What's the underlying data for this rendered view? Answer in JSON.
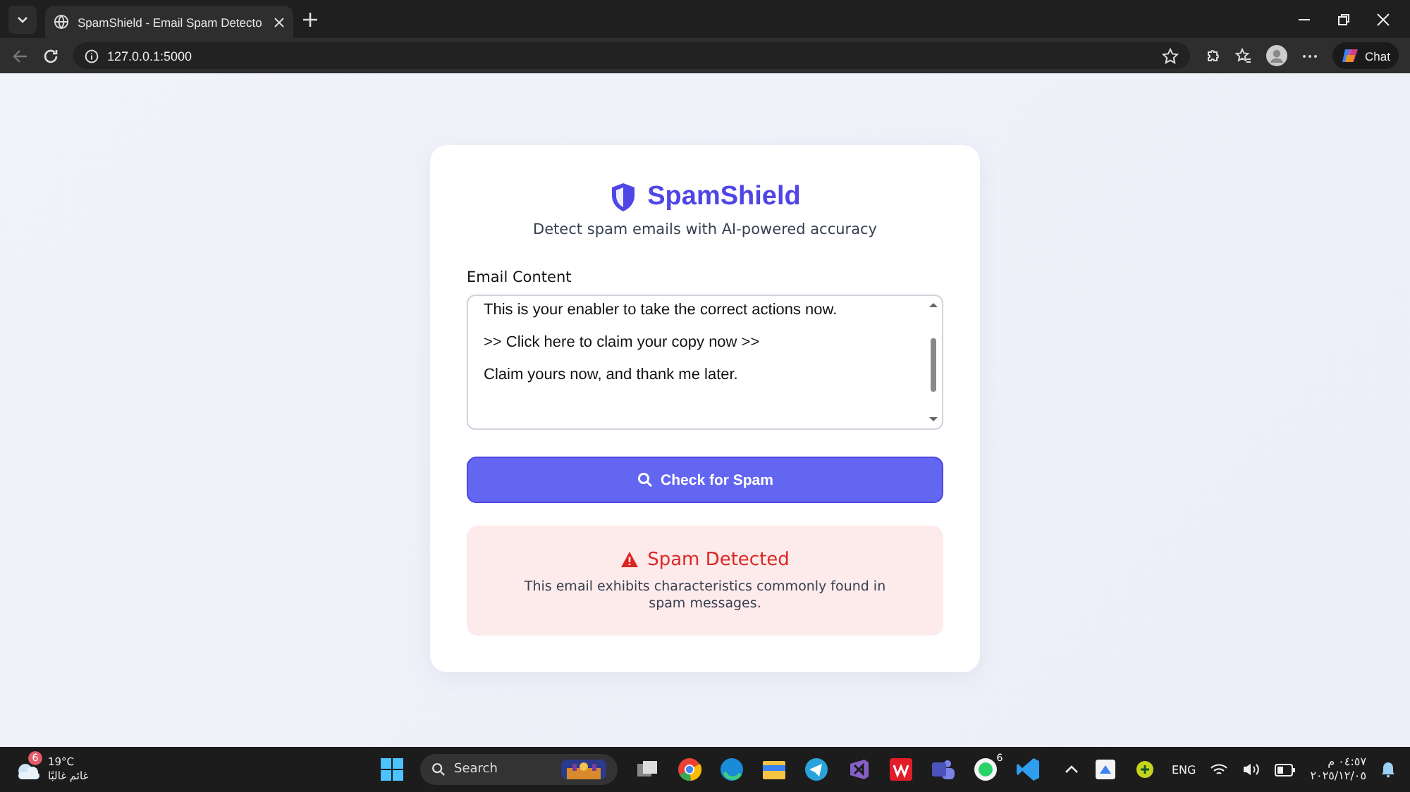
{
  "browser": {
    "tab_title": "SpamShield - Email Spam Detecto",
    "url": "127.0.0.1:5000",
    "chat_label": "Chat"
  },
  "app": {
    "brand": "SpamShield",
    "tagline": "Detect spam emails with AI-powered accuracy",
    "field_label": "Email Content",
    "email_lines": [
      "This is your enabler to take the correct actions now.",
      ">> Click here to claim your copy now >>",
      "Claim yours now, and thank me later."
    ],
    "button": "Check for Spam",
    "result": {
      "kind": "spam",
      "title": "Spam Detected",
      "message": "This email exhibits characteristics commonly found in spam messages."
    }
  },
  "taskbar": {
    "weather_badge": "6",
    "temperature": "19°C",
    "condition": "غائم غالبًا",
    "search_placeholder": "Search",
    "whatsapp_badge": "6",
    "language": "ENG",
    "time": "٠٤:٥٧ م",
    "date": "٢٠٢٥/١٢/٠٥"
  }
}
